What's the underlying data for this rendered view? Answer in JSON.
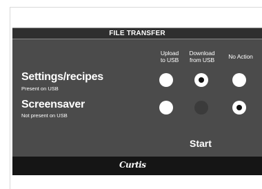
{
  "panel": {
    "title": "FILE TRANSFER"
  },
  "columns": [
    {
      "label": "Upload\nto USB"
    },
    {
      "label": "Download\nfrom USB"
    },
    {
      "label": "No Action"
    }
  ],
  "rows": [
    {
      "title": "Settings/recipes",
      "subtitle": "Present on USB",
      "options": [
        "unselected",
        "selected",
        "unselected"
      ]
    },
    {
      "title": "Screensaver",
      "subtitle": "Not present on USB",
      "options": [
        "unselected",
        "disabled",
        "selected"
      ]
    }
  ],
  "actions": {
    "start_label": "Start"
  },
  "footer": {
    "brand": "Curtis"
  },
  "colors": {
    "screen_bg": "#4b4b4b",
    "title_bar_bg": "#2f2f2f",
    "footer_bg": "#151515",
    "text": "#ffffff"
  }
}
